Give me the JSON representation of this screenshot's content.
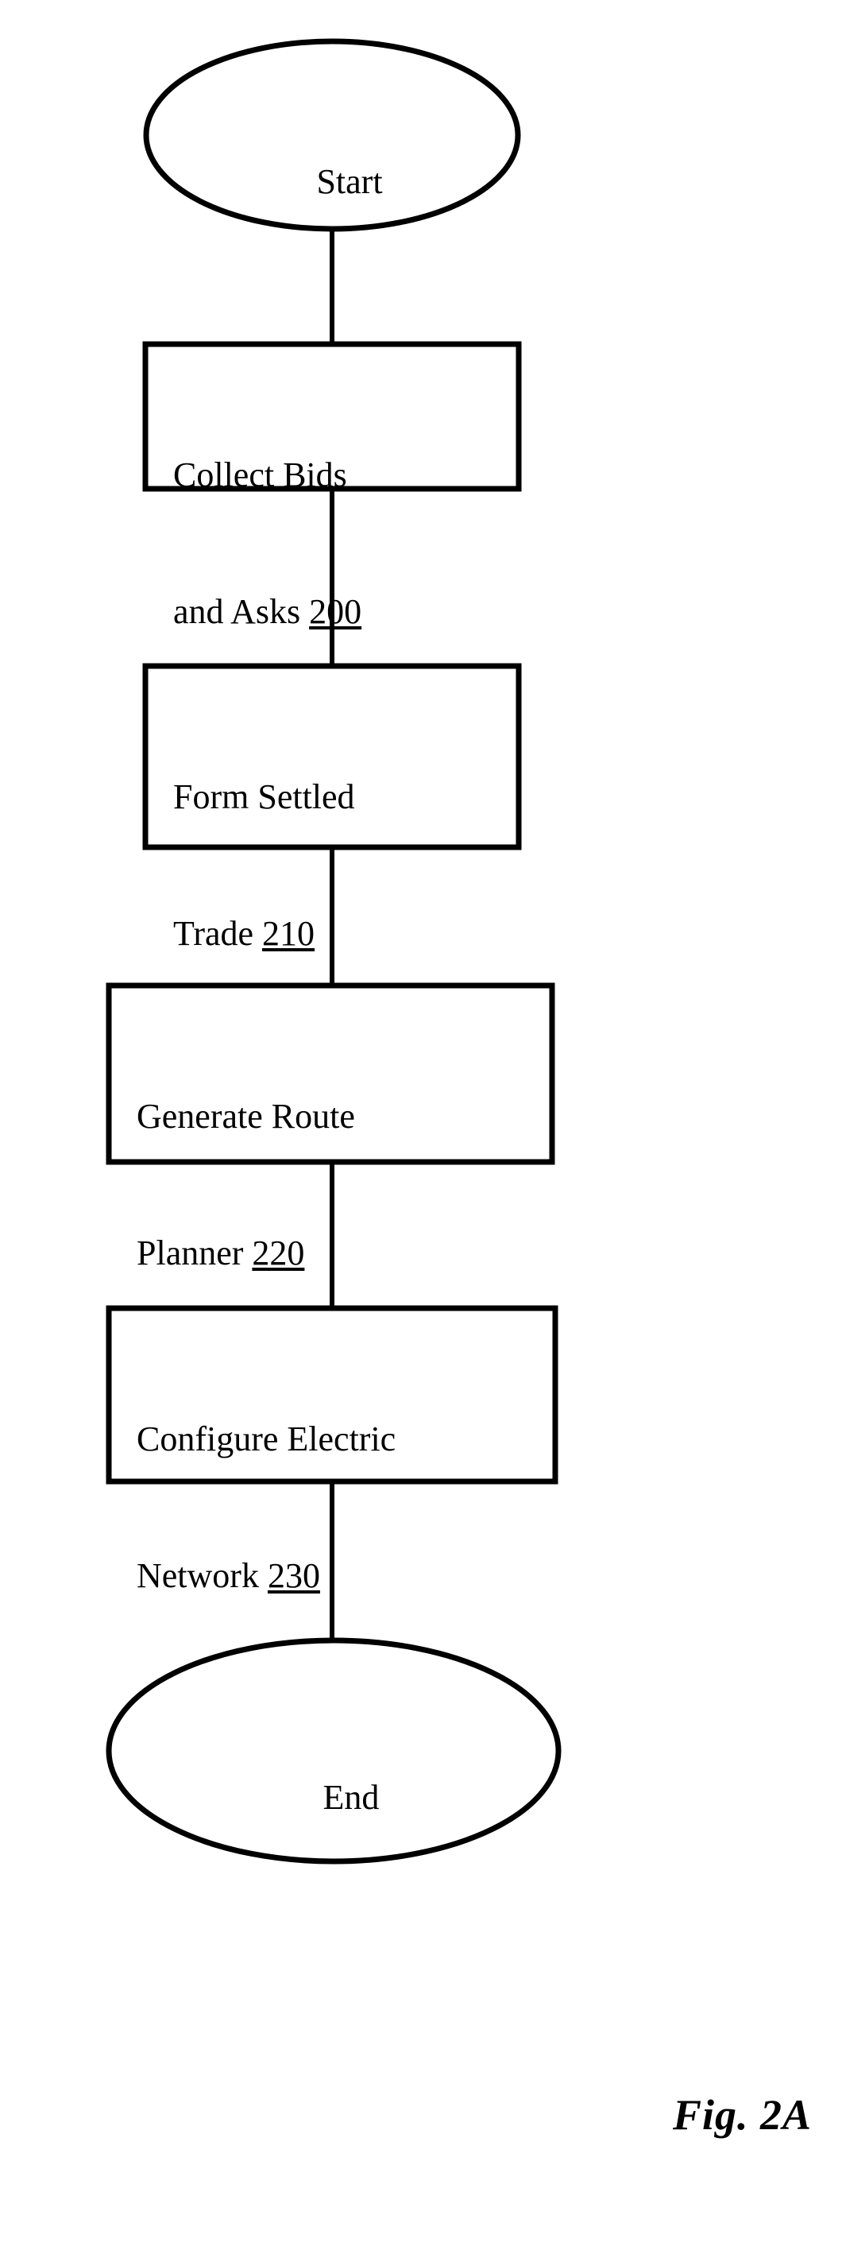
{
  "figure": {
    "caption": "Fig. 2A",
    "ink_color": "#000000",
    "background_color": "#ffffff"
  },
  "chart_data": {
    "type": "diagram",
    "subtype": "flowchart",
    "title": "Fig. 2A",
    "orientation": "top-to-bottom",
    "nodes": [
      {
        "id": "start",
        "shape": "ellipse",
        "label": "Start",
        "ref": ""
      },
      {
        "id": "step-200",
        "shape": "rectangle",
        "label": "Collect Bids and Asks",
        "ref": "200"
      },
      {
        "id": "step-210",
        "shape": "rectangle",
        "label": "Form Settled Trade",
        "ref": "210"
      },
      {
        "id": "step-220",
        "shape": "rectangle",
        "label": "Generate Route Planner",
        "ref": "220"
      },
      {
        "id": "step-230",
        "shape": "rectangle",
        "label": "Configure Electric Network",
        "ref": "230"
      },
      {
        "id": "end",
        "shape": "ellipse",
        "label": "End",
        "ref": ""
      }
    ],
    "edges": [
      {
        "from": "start",
        "to": "step-200"
      },
      {
        "from": "step-200",
        "to": "step-210"
      },
      {
        "from": "step-210",
        "to": "step-220"
      },
      {
        "from": "step-220",
        "to": "step-230"
      },
      {
        "from": "step-230",
        "to": "end"
      }
    ]
  },
  "nodes": {
    "start": {
      "label": "Start"
    },
    "collect_bids": {
      "line1": "Collect Bids",
      "line2_text": "and Asks ",
      "ref": "200"
    },
    "form_settled_trade": {
      "line1": "Form Settled",
      "line2_text": "Trade ",
      "ref": "210"
    },
    "generate_route_planner": {
      "line1": "Generate Route",
      "line2_text": "Planner ",
      "ref": "220"
    },
    "configure_electric_network": {
      "line1": "Configure Electric",
      "line2_text": "Network ",
      "ref": "230"
    },
    "end": {
      "label": "End"
    }
  }
}
